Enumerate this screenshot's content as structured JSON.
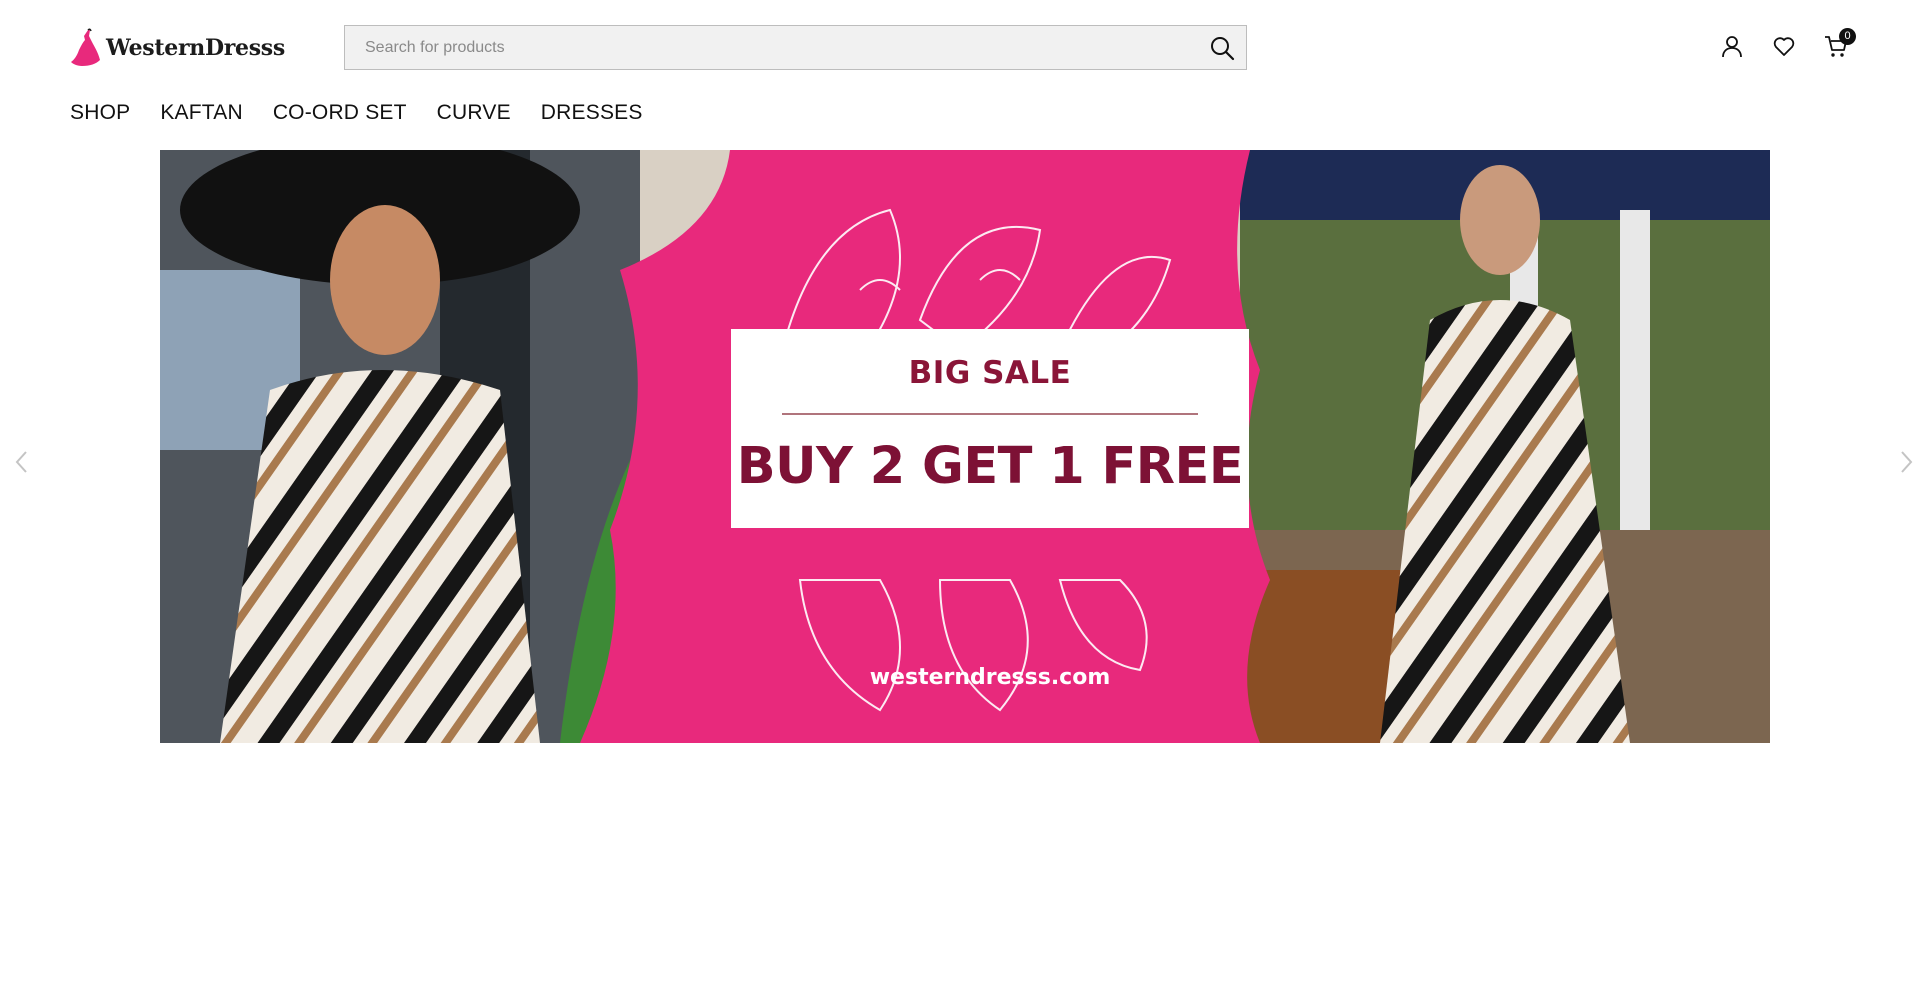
{
  "brand": {
    "name": "WesternDresss",
    "accent": "#e8297c"
  },
  "search": {
    "placeholder": "Search for products",
    "value": ""
  },
  "header_icons": {
    "account": "user-icon",
    "wishlist": "heart-icon",
    "cart": "cart-icon",
    "cart_count": "0"
  },
  "nav": {
    "items": [
      "SHOP",
      "KAFTAN",
      "CO-ORD SET",
      "CURVE",
      "DRESSES"
    ]
  },
  "banner": {
    "headline": "BIG SALE",
    "offer": "BUY 2 GET 1 FREE",
    "website": "westerndresss.com",
    "background_color": "#e8297c",
    "text_color": "#7d1135"
  },
  "carousel": {
    "prev": "chevron-left-icon",
    "next": "chevron-right-icon"
  }
}
